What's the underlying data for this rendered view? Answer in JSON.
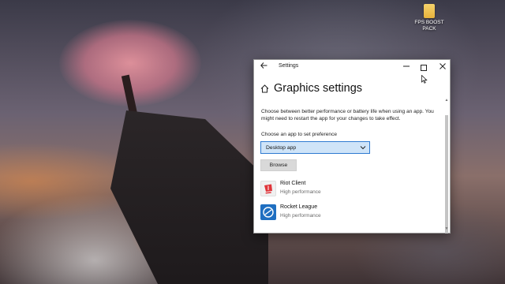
{
  "desktop": {
    "icons": [
      {
        "label": "FPS BOOST PACK",
        "icon": "folder-icon"
      }
    ]
  },
  "window": {
    "title": "Settings",
    "controls": {
      "minimize": "minimize-icon",
      "maximize": "maximize-icon",
      "close": "close-icon"
    },
    "back": "back-arrow-icon"
  },
  "page": {
    "icon": "home-icon",
    "title": "Graphics settings",
    "description": "Choose between better performance or battery life when using an app. You might need to restart the app for your changes to take effect.",
    "preference_label": "Choose an app to set preference",
    "dropdown": {
      "selected": "Desktop app",
      "icon": "chevron-down-icon"
    },
    "browse_label": "Browse",
    "apps": [
      {
        "name": "Riot Client",
        "preference": "High performance",
        "icon": "riot-client-icon"
      },
      {
        "name": "Rocket League",
        "preference": "High performance",
        "icon": "rocket-league-icon"
      }
    ]
  },
  "colors": {
    "accent": "#2f7bd1",
    "dropdown_fill": "#cfe4f8",
    "button_fill": "#d9d9d9",
    "riot_red": "#e0343a",
    "rocket_blue": "#1f6fc1"
  }
}
